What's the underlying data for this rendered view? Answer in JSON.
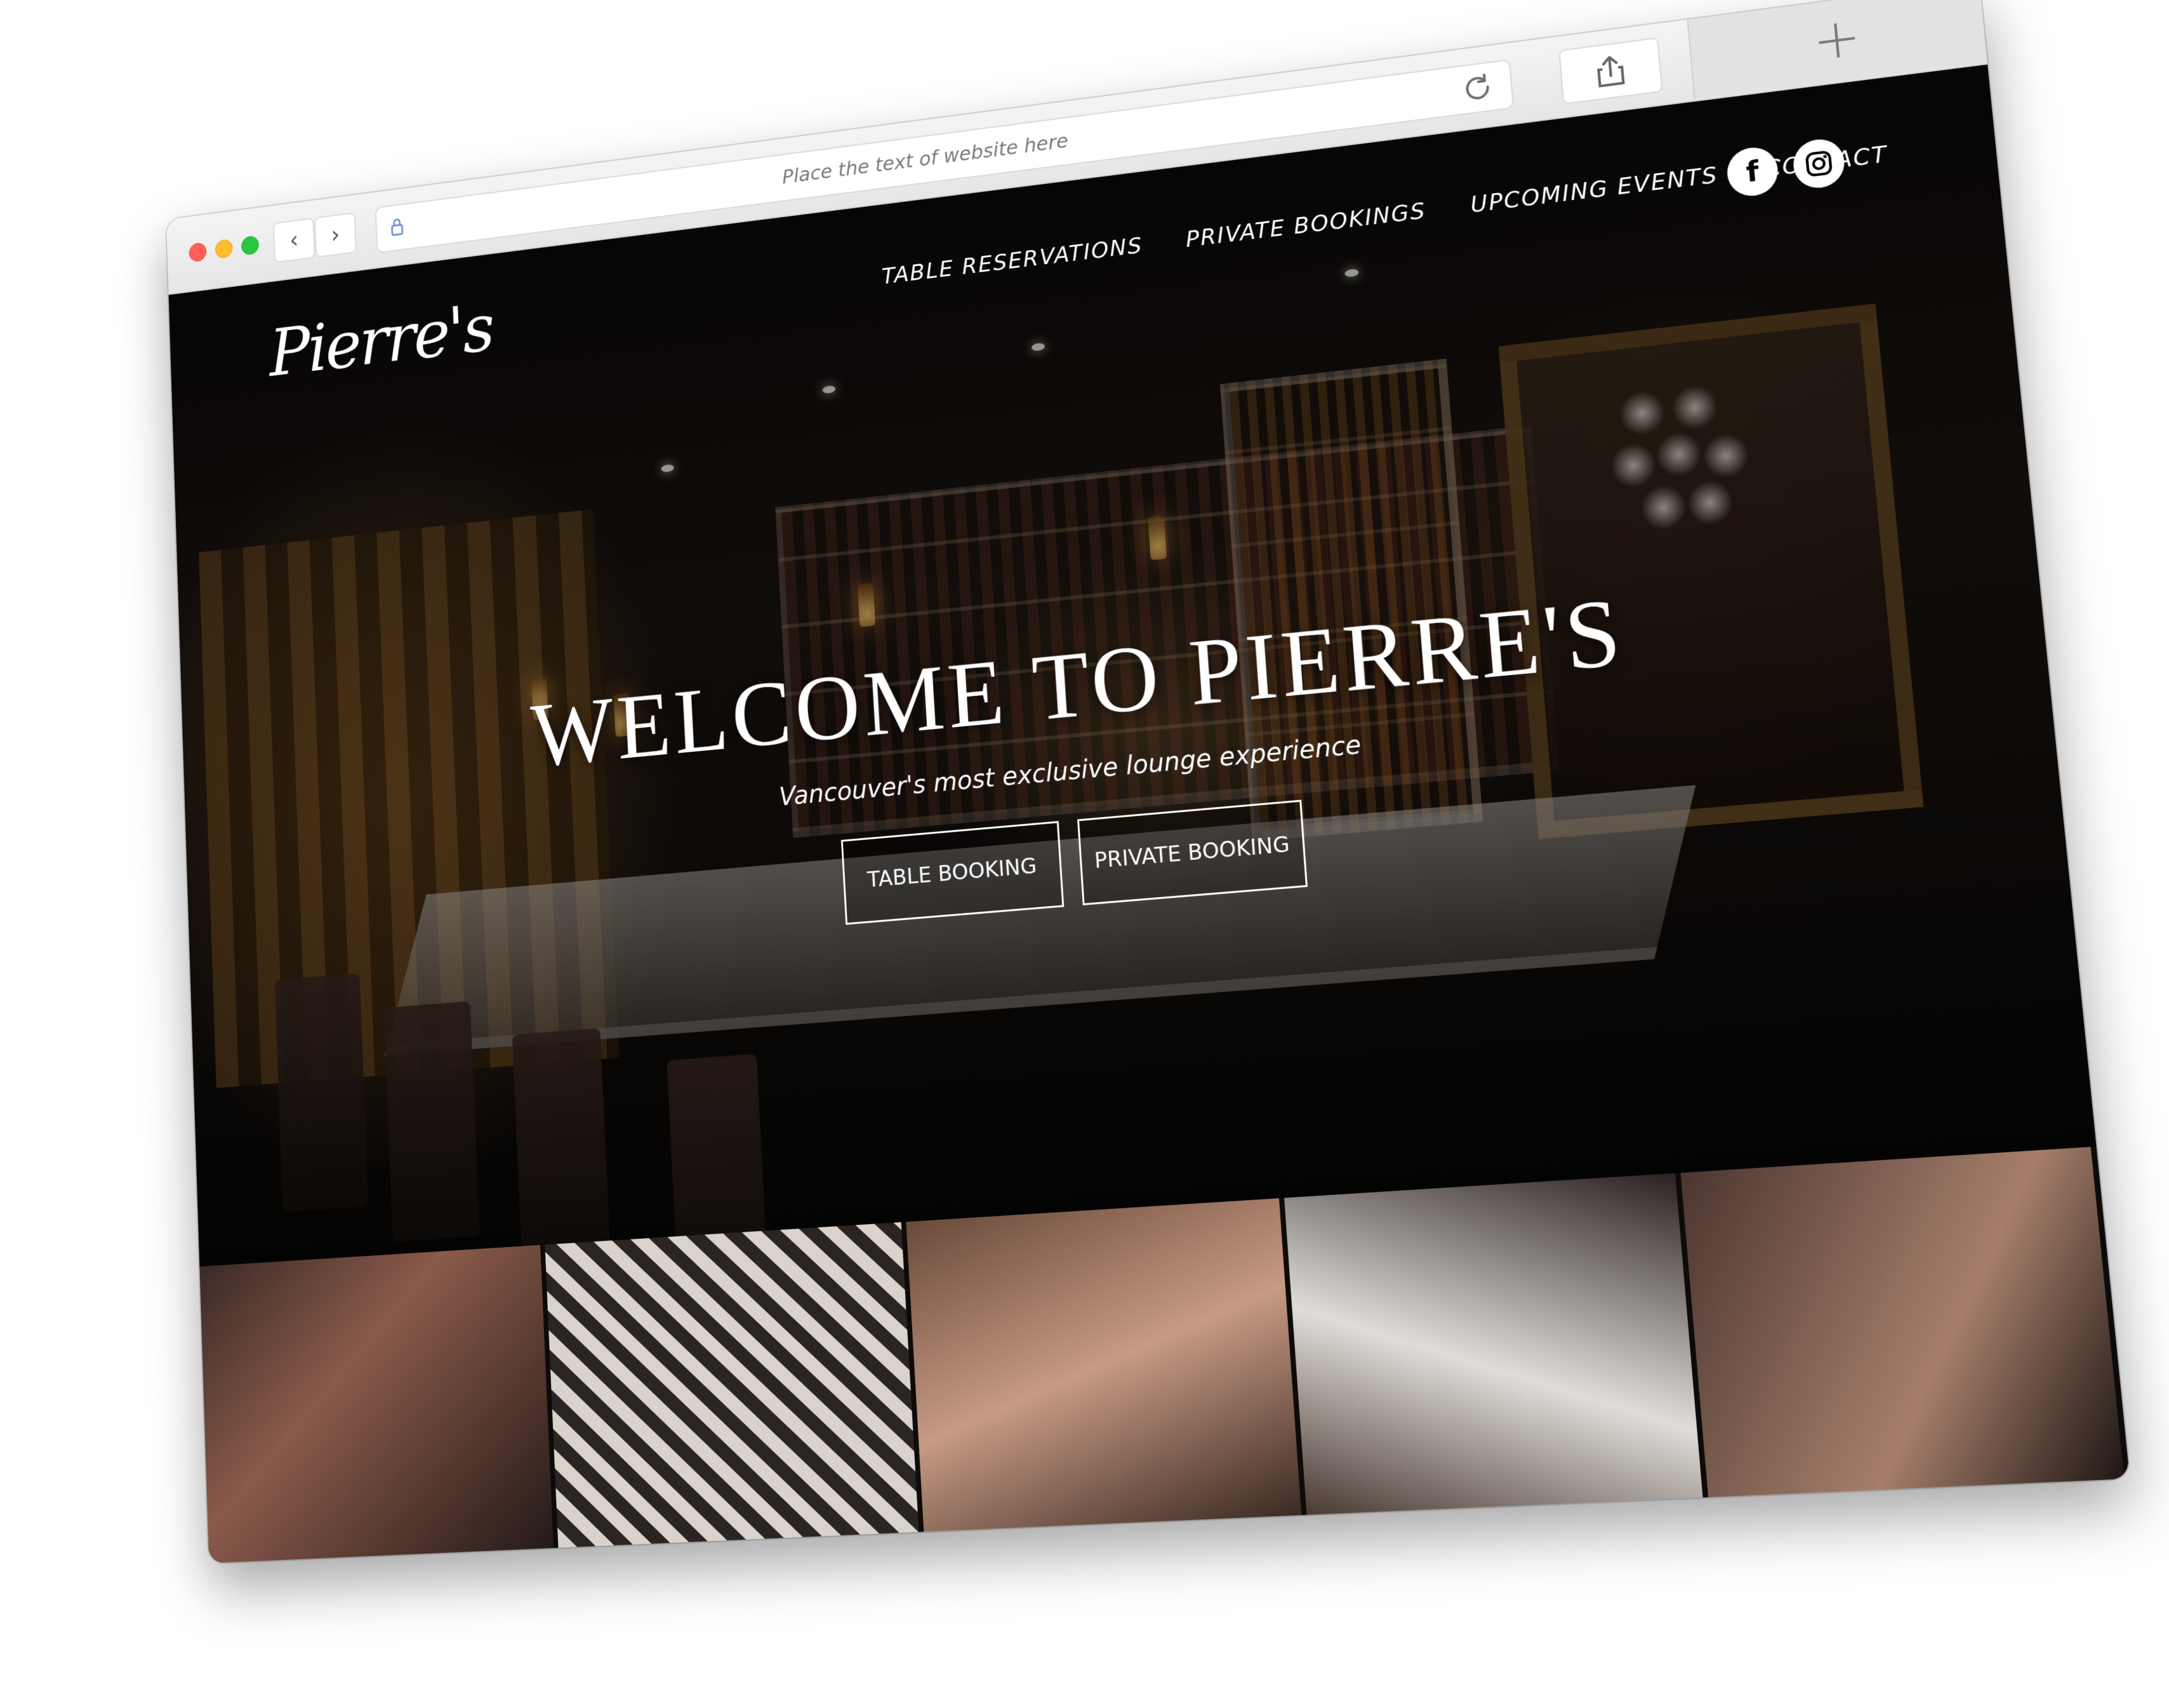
{
  "browser": {
    "address_text": "Place the text of website here",
    "back_glyph": "‹",
    "forward_glyph": "›",
    "icons": {
      "lock": "lock-icon",
      "reload": "reload-icon",
      "share": "share-icon",
      "new_tab": "plus-icon"
    }
  },
  "site": {
    "logo_text": "Pierre's",
    "nav": [
      {
        "label": "TABLE RESERVATIONS"
      },
      {
        "label": "PRIVATE BOOKINGS"
      },
      {
        "label": "UPCOMING EVENTS"
      },
      {
        "label": "CONTACT"
      }
    ],
    "social": {
      "facebook_glyph": "f",
      "instagram": "instagram-icon"
    }
  },
  "hero": {
    "title": "WELCOME TO PIERRE'S",
    "subtitle": "Vancouver's most exclusive lounge experience",
    "buttons": [
      {
        "label": "TABLE BOOKING"
      },
      {
        "label": "PRIVATE BOOKING"
      }
    ]
  },
  "colors": {
    "traffic_red": "#ff5f57",
    "traffic_yellow": "#febc2e",
    "traffic_green": "#28c840"
  }
}
